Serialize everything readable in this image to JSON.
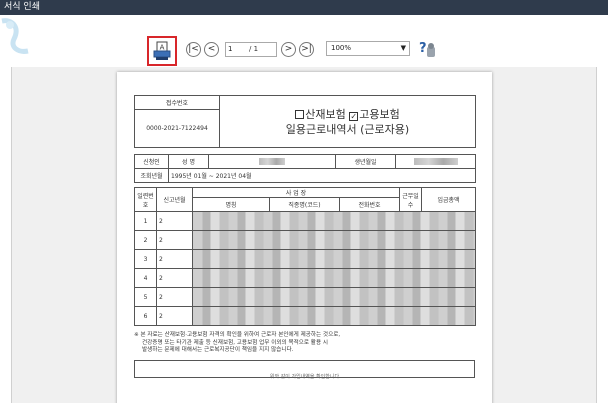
{
  "window": {
    "title": "서식 인쇄"
  },
  "toolbar": {
    "page_current": "1",
    "page_total": "/ 1",
    "zoom": "100%",
    "nav": {
      "first": "|<",
      "prev": "<",
      "next": ">",
      "last": ">|"
    }
  },
  "document": {
    "receipt_label": "접수번호",
    "receipt_number": "0000-2021-7122494",
    "title_line1_opt1": "산재보험",
    "title_line1_opt2": "고용보험",
    "title_line2": "일용근로내역서 (근로자용)",
    "applicant_label": "신청인",
    "name_label": "성 명",
    "birth_label": "생년월일",
    "period_label": "조회년월",
    "period_value": "1995년 01월 ~ 2021년 04월",
    "col_seq": "일련번호",
    "col_report": "신고년월",
    "col_workplace": "사 업 장",
    "col_name": "명칭",
    "col_industry": "직종명(코드)",
    "col_phone": "전화번호",
    "col_days": "근무일수",
    "col_wage": "임금총액",
    "rows": [
      {
        "no": "1",
        "ym": "2"
      },
      {
        "no": "2",
        "ym": "2"
      },
      {
        "no": "3",
        "ym": "2"
      },
      {
        "no": "4",
        "ym": "2"
      },
      {
        "no": "5",
        "ym": "2"
      },
      {
        "no": "6",
        "ym": "2"
      }
    ],
    "note_line1": "※ 본 자료는 산재보험·고용보험 자격의 확인을 위하여 근로자 본인에게 제공하는 것으로,",
    "note_line2": "건강증명 또는 타기관 제출 등 신재보험, 고용보험 업무 이외의 목적으로 활용 시",
    "note_line3": "발생하는 문제에 대해서는 근로복지공단이 책임을 지지 않습니다.",
    "bottom_text": "위와 같이 가입내역을 확인합니다"
  }
}
